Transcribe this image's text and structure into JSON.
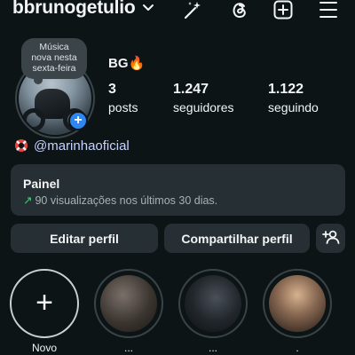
{
  "header": {
    "username": "bbrunogetulio",
    "icons": [
      "chevron-down-icon",
      "magic-wand-icon",
      "threads-icon",
      "add-post-icon",
      "menu-icon"
    ]
  },
  "profile": {
    "note_lines": [
      "Música",
      "nova nesta",
      "sexta-feira"
    ],
    "display_name": "BG🔥",
    "stats": [
      {
        "value": "3",
        "label": "posts"
      },
      {
        "value": "1.247",
        "label": "seguidores"
      },
      {
        "value": "1.122",
        "label": "seguindo"
      }
    ],
    "threads_handle": "@marinhaoficial"
  },
  "panel": {
    "title": "Painel",
    "subtitle": "90 visualizações nos últimos 30 dias.",
    "trend_color": "#3fcf7a"
  },
  "buttons": {
    "edit": "Editar perfil",
    "share": "Compartilhar perfil",
    "discover_icon": "add-person-icon"
  },
  "highlights": [
    {
      "label": "Novo"
    },
    {
      "label": "..."
    },
    {
      "label": "..."
    },
    {
      "label": "."
    }
  ],
  "colors": {
    "background": "#0c1416",
    "surface": "#263034",
    "accent_blue": "#2e86f0",
    "link": "#c8d2ff"
  }
}
